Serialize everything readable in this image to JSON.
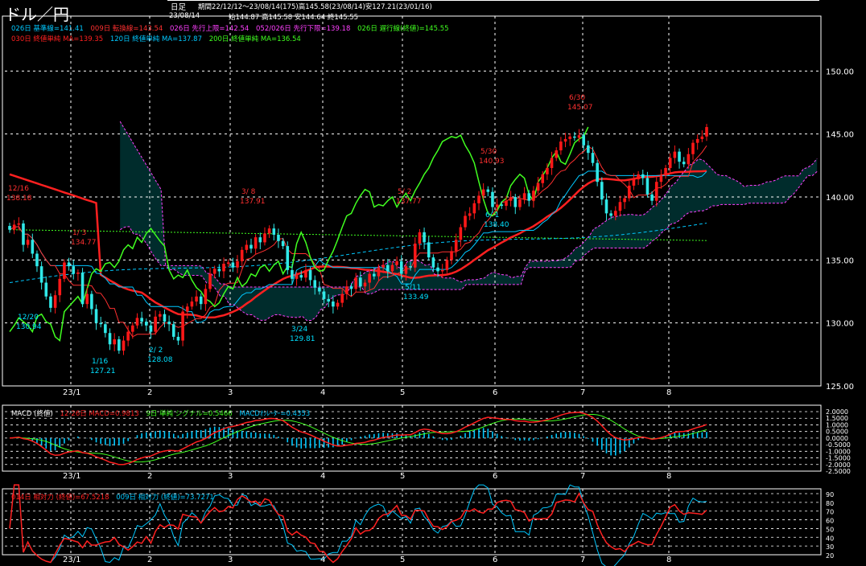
{
  "title": "ドル／円",
  "header": {
    "period_type": "日足",
    "period_info": "期間22/12/12～23/08/14(175)高145.58(23/08/14)安127.21(23/01/16)",
    "date": "23/08/14",
    "ohlc": "始144.87 高145.58 安144.64 終145.55"
  },
  "legend": {
    "row1": [
      {
        "text": "026日 基準線=141.41",
        "color": "#00c8ff"
      },
      {
        "text": "009日 転換線=143.54",
        "color": "#ff3030"
      },
      {
        "text": "026日 先行上限=142.54",
        "color": "#ff40ff"
      },
      {
        "text": "052/026日 先行下限=139.18",
        "color": "#ff40ff"
      },
      {
        "text": "026日 遅行線(終値)=145.55",
        "color": "#40ff20"
      }
    ],
    "row2": [
      {
        "text": "030日 終値単純 MA=139.35",
        "color": "#ff2020"
      },
      {
        "text": "120日 終値単純 MA=137.87",
        "color": "#00c8ff"
      },
      {
        "text": "200日 終値単純 MA=136.54",
        "color": "#40ff20"
      }
    ]
  },
  "macd_legend": [
    {
      "text": "MACD (終値)",
      "color": "#ffffff"
    },
    {
      "text": "12-26日 MACD=0.9813",
      "color": "#ff2020"
    },
    {
      "text": "9日 単純 シグナル=0.5466",
      "color": "#40ff20"
    },
    {
      "text": "MACDｵｼﾚｰﾀｰ=0.4353",
      "color": "#00c8ff"
    }
  ],
  "rsi_legend": [
    {
      "text": "014日 相対力 (終値)=67.5218",
      "color": "#ff2020"
    },
    {
      "text": "009日 相対力 (終値)=73.7271",
      "color": "#00c8ff"
    }
  ],
  "x_axis_labels": [
    "23/1",
    "2",
    "3",
    "4",
    "5",
    "6",
    "7",
    "8"
  ],
  "price_ticks": [
    "150.00",
    "145.00",
    "140.00",
    "135.00",
    "130.00",
    "125.00"
  ],
  "macd_ticks": [
    "2.0000",
    "1.5000",
    "1.0000",
    "0.5000",
    "0.0000",
    "-0.5000",
    "-1.0000",
    "-1.5000",
    "-2.0000",
    "-2.5000"
  ],
  "rsi_ticks": [
    "90",
    "80",
    "70",
    "60",
    "50",
    "40",
    "30",
    "20"
  ],
  "annotations": [
    {
      "date": "12/16",
      "value": "138.18",
      "color": "#ff3030"
    },
    {
      "date": "1/ 3",
      "value": "134.77",
      "color": "#ff3030"
    },
    {
      "date": "12/20",
      "value": "130.94",
      "color": "#00e0ff"
    },
    {
      "date": "1/16",
      "value": "127.21",
      "color": "#00e0ff"
    },
    {
      "date": "2/ 2",
      "value": "128.08",
      "color": "#00e0ff"
    },
    {
      "date": "3/ 8",
      "value": "137.91",
      "color": "#ff3030"
    },
    {
      "date": "3/24",
      "value": "129.81",
      "color": "#00e0ff"
    },
    {
      "date": "5/ 2",
      "value": "137.77",
      "color": "#ff3030"
    },
    {
      "date": "5/11",
      "value": "133.49",
      "color": "#00e0ff"
    },
    {
      "date": "5/30",
      "value": "140.93",
      "color": "#ff3030"
    },
    {
      "date": "6/ 1",
      "value": "138.40",
      "color": "#00e0ff"
    },
    {
      "date": "6/30",
      "value": "145.07",
      "color": "#ff3030"
    }
  ],
  "colors": {
    "up_candle": "#ff1818",
    "down_candle": "#30e8e8",
    "kijun": "#00c8ff",
    "tenkan": "#ff3030",
    "chikou": "#40ff20",
    "senkou": "#ff40ff",
    "cloud": "#00c8c8",
    "ma30": "#ff2020",
    "ma120": "#00c8ff",
    "ma200": "#40ff20",
    "macd": "#ff2020",
    "signal": "#40ff20",
    "osc": "#00c8ff",
    "rsi14": "#ff2020",
    "rsi9": "#00c8ff",
    "grid": "#ffffff"
  },
  "chart_data": [
    {
      "type": "candlestick",
      "title": "ドル／円",
      "period": "日足",
      "ylim": [
        125,
        152
      ],
      "x_labels": [
        "23/1",
        "2",
        "3",
        "4",
        "5",
        "6",
        "7",
        "8"
      ],
      "closes": [
        137.4,
        137.8,
        137.9,
        136.2,
        136.6,
        135.5,
        134.5,
        133.2,
        132.1,
        131.2,
        132.2,
        133.5,
        134.8,
        134.5,
        133.9,
        134.0,
        131.5,
        132.3,
        131.1,
        130.0,
        129.9,
        129.2,
        128.3,
        128.7,
        127.8,
        128.6,
        129.3,
        129.8,
        130.4,
        130.1,
        129.8,
        129.3,
        130.5,
        130.7,
        130.1,
        129.9,
        128.9,
        128.6,
        130.9,
        131.3,
        131.7,
        132.1,
        131.5,
        132.7,
        133.9,
        134.3,
        134.1,
        134.7,
        134.8,
        134.4,
        134.9,
        135.8,
        136.2,
        135.9,
        136.8,
        136.4,
        137.1,
        137.5,
        137.0,
        136.5,
        136.1,
        134.2,
        133.5,
        133.8,
        133.6,
        134.2,
        133.4,
        132.8,
        132.5,
        131.9,
        131.7,
        131.3,
        131.6,
        132.3,
        132.9,
        132.7,
        133.6,
        132.9,
        133.2,
        133.9,
        133.7,
        134.4,
        134.6,
        134.1,
        134.6,
        134.9,
        133.9,
        134.5,
        134.4,
        136.3,
        137.2,
        136.4,
        135.2,
        134.4,
        134.1,
        134.2,
        135.0,
        135.7,
        136.6,
        137.6,
        138.5,
        138.7,
        139.5,
        140.1,
        140.6,
        140.4,
        139.2,
        139.4,
        139.3,
        139.7,
        140.0,
        139.2,
        139.8,
        140.3,
        139.7,
        140.5,
        141.1,
        141.8,
        142.3,
        143.1,
        143.7,
        144.4,
        144.6,
        144.8,
        144.7,
        144.9,
        144.1,
        143.5,
        142.7,
        141.2,
        139.8,
        138.7,
        138.5,
        138.9,
        139.6,
        139.9,
        140.9,
        141.4,
        141.8,
        141.5,
        140.2,
        139.7,
        141.2,
        141.7,
        142.3,
        143.1,
        143.6,
        142.8,
        142.6,
        143.4,
        144.3,
        144.6,
        144.8,
        145.55
      ],
      "ma30_last": 139.35,
      "ma120_last": 137.87,
      "ma200_last": 136.54,
      "ichimoku": {
        "kijun": 141.41,
        "tenkan": 143.54,
        "senkou_a": 142.54,
        "senkou_b": 139.18,
        "chikou": 145.55
      },
      "last_ohlc": {
        "open": 144.87,
        "high": 145.58,
        "low": 144.64,
        "close": 145.55
      },
      "period_high": {
        "date": "23/08/14",
        "value": 145.58
      },
      "period_low": {
        "date": "23/01/16",
        "value": 127.21
      }
    },
    {
      "type": "line",
      "title": "MACD (終値)",
      "ylim": [
        -2.5,
        2.0
      ],
      "series": [
        {
          "name": "12-26日 MACD",
          "last": 0.9813
        },
        {
          "name": "9日 単純 シグナル",
          "last": 0.5466
        },
        {
          "name": "MACDｵｼﾚｰﾀｰ",
          "last": 0.4353
        }
      ]
    },
    {
      "type": "line",
      "title": "相対力",
      "ylim": [
        20,
        90
      ],
      "series": [
        {
          "name": "014日 相対力 (終値)",
          "last": 67.5218
        },
        {
          "name": "009日 相対力 (終値)",
          "last": 73.7271
        }
      ]
    }
  ]
}
